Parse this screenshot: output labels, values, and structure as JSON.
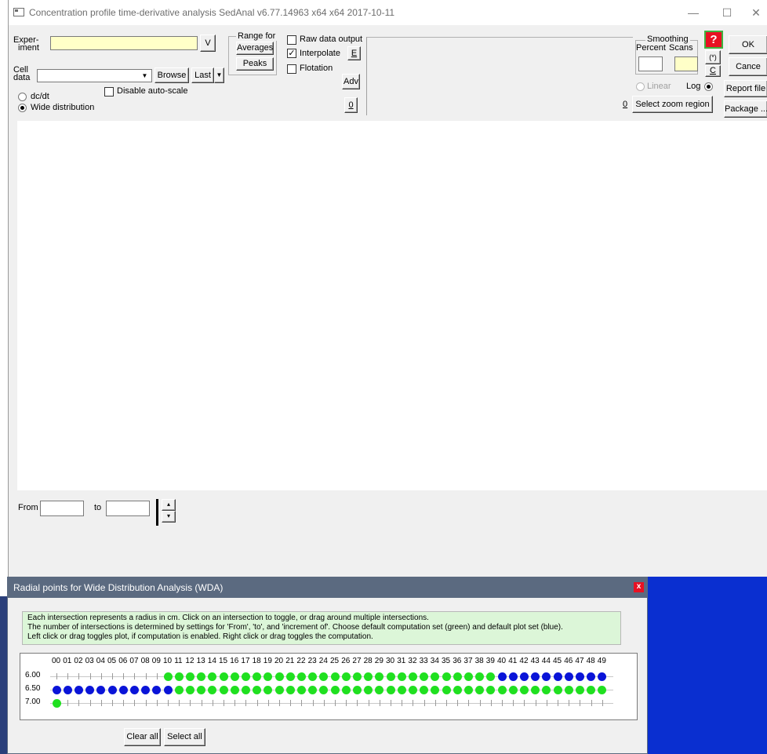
{
  "window": {
    "title": "Concentration profile time-derivative analysis  SedAnal v6.77.14963 x64 x64 2017-10-11",
    "minimize_glyph": "—",
    "maximize_glyph": "☐",
    "close_glyph": "✕"
  },
  "experiment": {
    "label_line1": "Exper-",
    "label_line2": "iment",
    "value": "",
    "v_button": "V"
  },
  "cell_data": {
    "label_line1": "Cell",
    "label_line2": "data",
    "value": "",
    "browse_button": "Browse",
    "last_button": "Last"
  },
  "disable_autoscale": {
    "label": "Disable auto-scale",
    "checked": false
  },
  "mode": {
    "dcdt": {
      "label": "dc/dt",
      "selected": false
    },
    "wide": {
      "label": "Wide distribution",
      "selected": true
    }
  },
  "range_for": {
    "title_line1": "Range for",
    "averages_button": "Averages",
    "peaks_button": "Peaks"
  },
  "options": {
    "raw_data_output": {
      "label": "Raw data output",
      "checked": false
    },
    "interpolate": {
      "label": "Interpolate",
      "checked": true
    },
    "flotation": {
      "label": "Flotation",
      "checked": false
    },
    "e_button": "E",
    "adv_button": "Adv",
    "zero_button": "0"
  },
  "smoothing": {
    "title": "Smoothing",
    "percent_label": "Percent",
    "scans_label": "Scans",
    "percent_value": "",
    "scans_value": "",
    "star_button": "(*)",
    "c_button": "C",
    "linear_label": "Linear",
    "log_label": "Log",
    "zero_button": "0",
    "zoom_button": "Select zoom region"
  },
  "help_button": "?",
  "right_buttons": {
    "ok": "OK",
    "cancel": "Cance",
    "report": "Report file",
    "package": "Package ..."
  },
  "range": {
    "from_label": "From",
    "to_label": "to",
    "from_value": "",
    "to_value": "",
    "spin_up": "▴",
    "spin_down": "▾"
  },
  "wda": {
    "title": "Radial points for Wide Distribution Analysis (WDA)",
    "close_glyph": "x",
    "info_line1": "Each intersection represents a radius in cm.  Click on an intersection to toggle, or drag around multiple intersections.",
    "info_line2": "The number of intersections is determined by settings for 'From', 'to', and 'increment of'. Choose default computation set (green) and default plot set (blue).",
    "info_line3": "Left click or drag toggles plot, if computation is enabled. Right click or drag toggles the computation.",
    "columns": [
      "00",
      "01",
      "02",
      "03",
      "04",
      "05",
      "06",
      "07",
      "08",
      "09",
      "10",
      "11",
      "12",
      "13",
      "14",
      "15",
      "16",
      "17",
      "18",
      "19",
      "20",
      "21",
      "22",
      "23",
      "24",
      "25",
      "26",
      "27",
      "28",
      "29",
      "30",
      "31",
      "32",
      "33",
      "34",
      "35",
      "36",
      "37",
      "38",
      "39",
      "40",
      "41",
      "42",
      "43",
      "44",
      "45",
      "46",
      "47",
      "48",
      "49"
    ],
    "rows": [
      {
        "label": "6.00",
        "dots": "..........GGGGGGGGGGGGGGGGGGGGGGGGGGGGGGBBBBBBBBBB"
      },
      {
        "label": "6.50",
        "dots": "BBBBBBBBBBBGGGGGGGGGGGGGGGGGGGGGGGGGGGGGGGGGGGGGGG"
      },
      {
        "label": "7.00",
        "dots": "G................................................."
      }
    ],
    "colors": {
      "green": "#20e020",
      "blue": "#0a14d8"
    },
    "clear_all_button": "Clear all",
    "select_all_button": "Select all"
  }
}
